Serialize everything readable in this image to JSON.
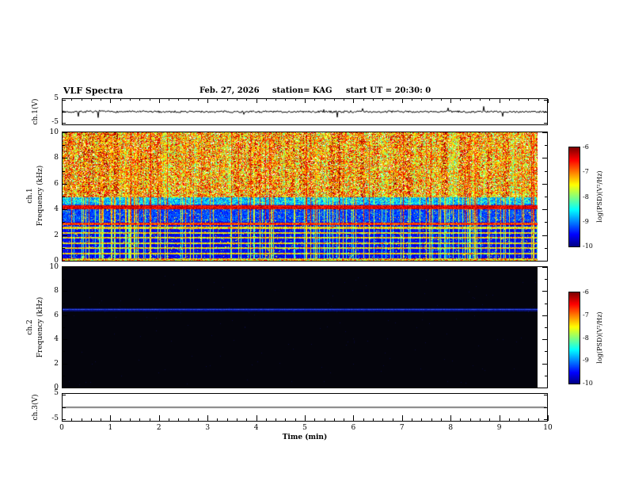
{
  "header": {
    "title": "VLF Spectra",
    "date": "Feb. 27, 2026",
    "station_label": "station= KAG",
    "start_ut_label": "start UT =  20:30: 0"
  },
  "axes": {
    "x": {
      "label": "Time (min)",
      "min": 0,
      "max": 10,
      "major_tick_labels": [
        "0",
        "1",
        "2",
        "3",
        "4",
        "5",
        "6",
        "7",
        "8",
        "9",
        "10"
      ],
      "minors_per_major": 5,
      "data_end_min": 9.8
    },
    "freq": {
      "min": 0,
      "max": 10,
      "tick_labels": [
        "0",
        "2",
        "4",
        "6",
        "8",
        "10"
      ]
    },
    "volt": {
      "min": -5,
      "max": 5,
      "max_label": "5",
      "min_label": "-5"
    }
  },
  "panels": {
    "ch1_wave": {
      "ylabel": "ch.1(V)"
    },
    "ch1_spec": {
      "ylabel_ch": "ch.1",
      "ylabel_freq": "Frequency (kHz)"
    },
    "ch2_spec": {
      "ylabel_ch": "ch.2",
      "ylabel_freq": "Frequency (kHz)"
    },
    "ch3_wave": {
      "ylabel": "ch.3(V)"
    }
  },
  "colorbar": {
    "label": "log(PSD)(V²/Hz)",
    "tick_labels": [
      "-6",
      "-7",
      "-8",
      "-9",
      "-10"
    ],
    "top_value": -6,
    "bottom_value": -10,
    "colormap": "jet"
  },
  "chart_data": [
    {
      "type": "line",
      "name": "ch1_voltage_waveform",
      "ylabel": "ch.1(V)",
      "ylim": [
        -5,
        5
      ],
      "xlim": [
        0,
        10
      ],
      "description": "noisy trace near 0 V with intermittent narrow spikes to about ±2 V",
      "baseline_v": 0,
      "noise_v": 0.4,
      "spike_rate": 0.03,
      "spike_v": 2.2,
      "seed": 7
    },
    {
      "type": "heatmap",
      "name": "ch1_spectrogram",
      "xlim": [
        0,
        10
      ],
      "ylim_khz": [
        0,
        10
      ],
      "colorbar_range_log_psd": [
        -10,
        -6
      ],
      "colormap": "jet",
      "seed": 12345,
      "features": [
        {
          "kind": "broadband_band",
          "freq_khz": [
            5,
            10
          ],
          "level": "high (yellow-red), dense vertical striations"
        },
        {
          "kind": "strong_line",
          "freq_khz": 4.2,
          "level": "about -6 (red), continuous"
        },
        {
          "kind": "line",
          "freq_khz": 2.9,
          "level": "strong (orange-red), thin"
        },
        {
          "kind": "quiet_band",
          "freq_khz": [
            3.05,
            4.05
          ],
          "level": "low (blue/black)"
        },
        {
          "kind": "harmonic_lines",
          "freqs_khz": [
            0.6,
            1.0,
            1.4,
            1.8,
            2.2,
            2.6
          ],
          "level": "medium (green)"
        },
        {
          "kind": "vertical_streaks",
          "span_khz": [
            0,
            10
          ],
          "level": "high (red) above 5 kHz, medium (green) below"
        }
      ],
      "render": {
        "bright_min_khz": 5,
        "strong_line_khz": 4.2,
        "mid_line_khz": 2.9,
        "quiet_band_khz": [
          3.05,
          4.05
        ],
        "harmonics": [
          0.6,
          1.0,
          1.4,
          1.8,
          2.2,
          2.6
        ],
        "event_rate": 0.22
      }
    },
    {
      "type": "heatmap",
      "name": "ch2_spectrogram",
      "xlim": [
        0,
        10
      ],
      "ylim_khz": [
        0,
        10
      ],
      "colorbar_range_log_psd": [
        -10,
        -6
      ],
      "colormap": "jet",
      "seed": 99,
      "background_level_log_psd": -10,
      "features": [
        {
          "kind": "line",
          "freq_khz": 6.5,
          "level": "about -8.5 (blue), continuous thin"
        }
      ],
      "render": {
        "line_khz": 6.5
      }
    },
    {
      "type": "line",
      "name": "ch3_voltage_waveform",
      "ylabel": "ch.3(V)",
      "ylim": [
        -5,
        5
      ],
      "xlim": [
        0,
        10
      ],
      "description": "flat line at 0 V",
      "baseline_v": 0,
      "noise_v": 0,
      "spike_rate": 0,
      "spike_v": 0,
      "seed": 1
    }
  ]
}
